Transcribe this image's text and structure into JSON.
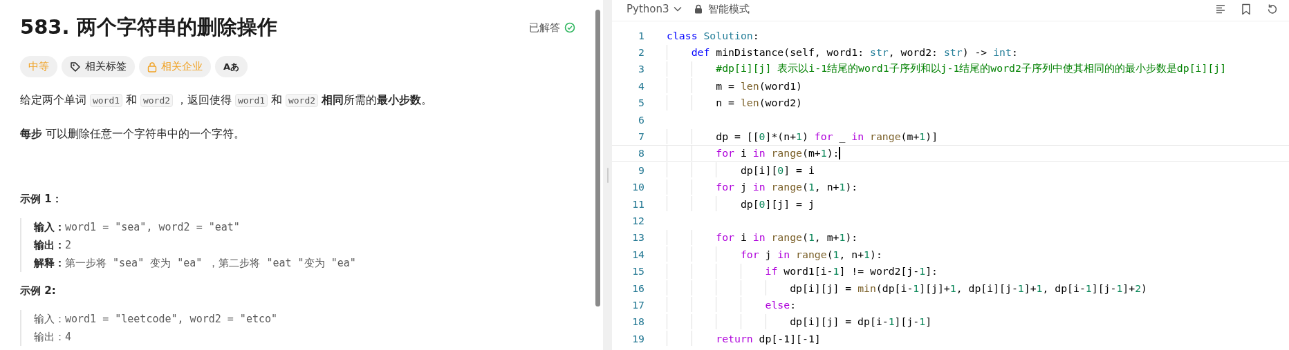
{
  "problem": {
    "title": "583. 两个字符串的删除操作",
    "status": "已解答",
    "tags": [
      {
        "label": "中等",
        "kind": "difficulty"
      },
      {
        "label": "相关标签",
        "kind": "tag"
      },
      {
        "label": "相关企业",
        "kind": "locked"
      },
      {
        "label": "Aあ",
        "kind": "translate"
      }
    ],
    "description": [
      {
        "kind": "text",
        "text": "给定两个单词 "
      },
      {
        "kind": "code",
        "text": "word1"
      },
      {
        "kind": "text",
        "text": " 和 "
      },
      {
        "kind": "code",
        "text": "word2"
      },
      {
        "kind": "text",
        "text": " ，返回使得 "
      },
      {
        "kind": "code",
        "text": "word1"
      },
      {
        "kind": "text",
        "text": " 和  "
      },
      {
        "kind": "code",
        "text": "word2"
      },
      {
        "kind": "text",
        "text": " **相同**所需的**最小步数**。"
      }
    ],
    "step_note": "**每步** 可以删除任意一个字符串中的一个字符。",
    "examples": [
      {
        "heading": "示例 1：",
        "lines": [
          "**输入：**word1 = \"sea\", word2 = \"eat\"",
          "**输出：**2",
          "**解释：**第一步将 \"sea\" 变为 \"ea\" ，第二步将 \"eat \"变为 \"ea\""
        ]
      },
      {
        "heading": "示例  2:",
        "lines": [
          "输入：word1 = \"leetcode\", word2 = \"etco\"",
          "输出：4"
        ]
      }
    ]
  },
  "editor": {
    "language": "Python3",
    "mode": "智能模式",
    "lines": [
      {
        "number": "1",
        "active": false,
        "tokens": [
          {
            "kind": "decl",
            "text": "class"
          },
          {
            "kind": "class",
            "text": " Solution"
          },
          {
            "kind": "plain",
            "text": ":"
          }
        ]
      },
      {
        "number": "2",
        "active": false,
        "tokens": [
          {
            "kind": "decl",
            "text": "    def"
          },
          {
            "kind": "plain",
            "text": " minDistance(self, word1: "
          },
          {
            "kind": "type",
            "text": "str"
          },
          {
            "kind": "plain",
            "text": ", word2: "
          },
          {
            "kind": "type",
            "text": "str"
          },
          {
            "kind": "plain",
            "text": ") -> "
          },
          {
            "kind": "type",
            "text": "int"
          },
          {
            "kind": "plain",
            "text": ":"
          }
        ]
      },
      {
        "number": "3",
        "active": false,
        "tokens": [
          {
            "kind": "comment",
            "text": "        #dp[i][j] 表示以i-1结尾的word1子序列和以j-1结尾的word2子序列中使其相同的的最小步数是dp[i][j]"
          }
        ]
      },
      {
        "number": "4",
        "active": false,
        "tokens": [
          {
            "kind": "plain",
            "text": "        m = "
          },
          {
            "kind": "fn",
            "text": "len"
          },
          {
            "kind": "plain",
            "text": "(word1)"
          }
        ]
      },
      {
        "number": "5",
        "active": false,
        "tokens": [
          {
            "kind": "plain",
            "text": "        n = "
          },
          {
            "kind": "fn",
            "text": "len"
          },
          {
            "kind": "plain",
            "text": "(word2)"
          }
        ]
      },
      {
        "number": "6",
        "active": false
      },
      {
        "number": "7",
        "active": false,
        "tokens": [
          {
            "kind": "plain",
            "text": "        dp = [["
          },
          {
            "kind": "num",
            "text": "0"
          },
          {
            "kind": "plain",
            "text": "]*(n+"
          },
          {
            "kind": "num",
            "text": "1"
          },
          {
            "kind": "plain",
            "text": ") "
          },
          {
            "kind": "keyword",
            "text": "for"
          },
          {
            "kind": "plain",
            "text": " _ "
          },
          {
            "kind": "keyword",
            "text": "in"
          },
          {
            "kind": "fn",
            "text": " range"
          },
          {
            "kind": "plain",
            "text": "(m+"
          },
          {
            "kind": "num",
            "text": "1"
          },
          {
            "kind": "plain",
            "text": ")]"
          }
        ]
      },
      {
        "number": "8",
        "active": true,
        "tokens": [
          {
            "kind": "keyword",
            "text": "        for"
          },
          {
            "kind": "plain",
            "text": " i "
          },
          {
            "kind": "keyword",
            "text": "in"
          },
          {
            "kind": "fn",
            "text": " range"
          },
          {
            "kind": "plain",
            "text": "(m+"
          },
          {
            "kind": "num",
            "text": "1"
          },
          {
            "kind": "plain",
            "text": "):"
          }
        ]
      },
      {
        "number": "9",
        "active": false,
        "tokens": [
          {
            "kind": "plain",
            "text": "            dp[i]["
          },
          {
            "kind": "num",
            "text": "0"
          },
          {
            "kind": "plain",
            "text": "] = i"
          }
        ]
      },
      {
        "number": "10",
        "active": false,
        "tokens": [
          {
            "kind": "keyword",
            "text": "        for"
          },
          {
            "kind": "plain",
            "text": " j "
          },
          {
            "kind": "keyword",
            "text": "in"
          },
          {
            "kind": "fn",
            "text": " range"
          },
          {
            "kind": "plain",
            "text": "("
          },
          {
            "kind": "num",
            "text": "1"
          },
          {
            "kind": "plain",
            "text": ", n+"
          },
          {
            "kind": "num",
            "text": "1"
          },
          {
            "kind": "plain",
            "text": "):"
          }
        ]
      },
      {
        "number": "11",
        "active": false,
        "tokens": [
          {
            "kind": "plain",
            "text": "            dp["
          },
          {
            "kind": "num",
            "text": "0"
          },
          {
            "kind": "plain",
            "text": "][j] = j"
          }
        ]
      },
      {
        "number": "12",
        "active": false
      },
      {
        "number": "13",
        "active": false,
        "tokens": [
          {
            "kind": "keyword",
            "text": "        for"
          },
          {
            "kind": "plain",
            "text": " i "
          },
          {
            "kind": "keyword",
            "text": "in"
          },
          {
            "kind": "fn",
            "text": " range"
          },
          {
            "kind": "plain",
            "text": "("
          },
          {
            "kind": "num",
            "text": "1"
          },
          {
            "kind": "plain",
            "text": ", m+"
          },
          {
            "kind": "num",
            "text": "1"
          },
          {
            "kind": "plain",
            "text": "):"
          }
        ]
      },
      {
        "number": "14",
        "active": false,
        "tokens": [
          {
            "kind": "keyword",
            "text": "            for"
          },
          {
            "kind": "plain",
            "text": " j "
          },
          {
            "kind": "keyword",
            "text": "in"
          },
          {
            "kind": "fn",
            "text": " range"
          },
          {
            "kind": "plain",
            "text": "("
          },
          {
            "kind": "num",
            "text": "1"
          },
          {
            "kind": "plain",
            "text": ", n+"
          },
          {
            "kind": "num",
            "text": "1"
          },
          {
            "kind": "plain",
            "text": "):"
          }
        ]
      },
      {
        "number": "15",
        "active": false,
        "tokens": [
          {
            "kind": "keyword",
            "text": "                if"
          },
          {
            "kind": "plain",
            "text": " word1[i-"
          },
          {
            "kind": "num",
            "text": "1"
          },
          {
            "kind": "plain",
            "text": "] != word2[j-"
          },
          {
            "kind": "num",
            "text": "1"
          },
          {
            "kind": "plain",
            "text": "]:"
          }
        ]
      },
      {
        "number": "16",
        "active": false,
        "tokens": [
          {
            "kind": "plain",
            "text": "                    dp[i][j] = "
          },
          {
            "kind": "fn",
            "text": "min"
          },
          {
            "kind": "plain",
            "text": "(dp[i-"
          },
          {
            "kind": "num",
            "text": "1"
          },
          {
            "kind": "plain",
            "text": "][j]+"
          },
          {
            "kind": "num",
            "text": "1"
          },
          {
            "kind": "plain",
            "text": ", dp[i][j-"
          },
          {
            "kind": "num",
            "text": "1"
          },
          {
            "kind": "plain",
            "text": "]+"
          },
          {
            "kind": "num",
            "text": "1"
          },
          {
            "kind": "plain",
            "text": ", dp[i-"
          },
          {
            "kind": "num",
            "text": "1"
          },
          {
            "kind": "plain",
            "text": "][j-"
          },
          {
            "kind": "num",
            "text": "1"
          },
          {
            "kind": "plain",
            "text": "]+"
          },
          {
            "kind": "num",
            "text": "2"
          },
          {
            "kind": "plain",
            "text": ")"
          }
        ]
      },
      {
        "number": "17",
        "active": false,
        "tokens": [
          {
            "kind": "keyword",
            "text": "                else"
          },
          {
            "kind": "plain",
            "text": ":"
          }
        ]
      },
      {
        "number": "18",
        "active": false,
        "tokens": [
          {
            "kind": "plain",
            "text": "                    dp[i][j] = dp[i-"
          },
          {
            "kind": "num",
            "text": "1"
          },
          {
            "kind": "plain",
            "text": "][j-"
          },
          {
            "kind": "num",
            "text": "1"
          },
          {
            "kind": "plain",
            "text": "]"
          }
        ]
      },
      {
        "number": "19",
        "active": false,
        "tokens": [
          {
            "kind": "keyword",
            "text": "        return"
          },
          {
            "kind": "plain",
            "text": " dp[-1][-1]"
          }
        ]
      }
    ]
  }
}
